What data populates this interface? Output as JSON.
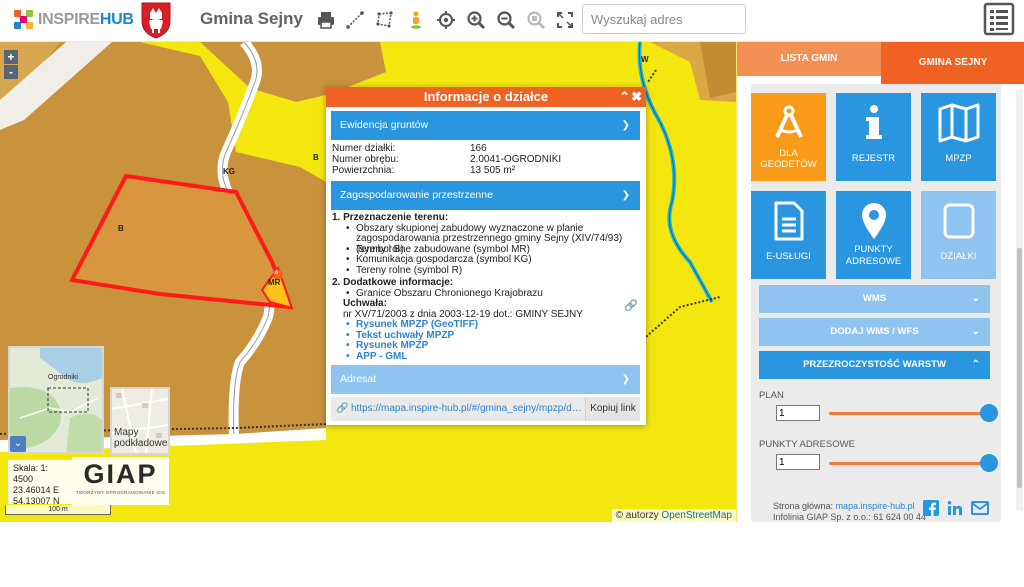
{
  "header": {
    "logo_prefix": "INSPIRE",
    "logo_suffix": "HUB",
    "title": "Gmina Sejny",
    "search_placeholder": "Wyszukaj adres",
    "tools": [
      "print-icon",
      "measure-line-icon",
      "measure-area-icon",
      "streetview-icon",
      "locate-icon",
      "zoom-in-icon",
      "zoom-out-icon",
      "zoom-box-icon",
      "fullscreen-icon"
    ]
  },
  "map": {
    "zoom_in": "+",
    "zoom_out": "-",
    "labels": {
      "w": "W",
      "kg": "KG",
      "b1": "B",
      "b2": "B",
      "mr": "MR",
      "six": "6"
    },
    "minimap_label": "Ogrodniki",
    "minimap_toggle": "⌄",
    "basemap_label": "Mapy podkładowe",
    "scale_text": "Skala: 1: 4500",
    "coord_e": "23.46014 E",
    "coord_n": "54.13007 N",
    "giap_logo": "GIAP",
    "giap_tagline": "TWORZYMY OPROGRAMOWANIE GIS",
    "scale_bar": "100 m",
    "attribution_prefix": "© autorzy",
    "attribution_link": "OpenStreetMap"
  },
  "popup": {
    "title": "Informacje o działce",
    "sections": {
      "ewidencja": "Ewidencja gruntów",
      "zagosp": "Zagospodarowanie przestrzenne",
      "adresat": "Adresat"
    },
    "fields": [
      {
        "label": "Numer działki:",
        "value": "166"
      },
      {
        "label": "Numer obrębu:",
        "value": "2.0041-OGRODNIKI"
      },
      {
        "label": "Powierzchnia:",
        "value": "13 505 m²"
      }
    ],
    "item1_title": "1.  Przeznaczenie terenu:",
    "item1_bullets": [
      "Obszary skupionej zabudowy wyznaczone w planie zagospodarowania przestrzennego gminy Sejny (XIV/74/93) (symbol B)",
      "Tereny rolne zabudowane (symbol MR)",
      "Komunikacja gospodarcza (symbol KG)",
      "Tereny rolne (symbol R)"
    ],
    "item2_title": "2.  Dodatkowe informacje:",
    "item2_bullet": "Granice Obszaru Chronionego Krajobrazu",
    "uchwala_label": "Uchwała:",
    "uchwala_text": "nr XV/71/2003 z dnia 2003-12-19 dot.: GMINY SEJNY",
    "links": [
      "Rysunek MPZP (GeoTIFF)",
      "Tekst uchwały MPZP",
      "Rysunek MPZP",
      "APP - GML"
    ],
    "share_url": "https://mapa.inspire-hub.pl/#/gmina_sejny/mpzp/dzialka/...",
    "copy_label": "Kopiuj link"
  },
  "panel": {
    "tab_lista": "LISTA GMIN",
    "tab_gmina": "GMINA SEJNY",
    "tiles": [
      {
        "label1": "DLA",
        "label2": "GEODETÓW",
        "icon": "compass-icon"
      },
      {
        "label1": "REJESTR",
        "label2": "",
        "icon": "info-icon"
      },
      {
        "label1": "MPZP",
        "label2": "",
        "icon": "map-icon"
      },
      {
        "label1": "E-USŁUGI",
        "label2": "",
        "icon": "document-icon"
      },
      {
        "label1": "PUNKTY",
        "label2": "ADRESOWE",
        "icon": "pin-icon"
      },
      {
        "label1": "DZIAŁKI",
        "label2": "",
        "icon": "parcel-icon"
      }
    ],
    "sections": [
      "WMS",
      "DODAJ WMS / WFS",
      "PRZEZROCZYSTOŚĆ WARSTW"
    ],
    "layers": [
      {
        "name": "PLAN",
        "value": "1",
        "opacity": 1
      },
      {
        "name": "PUNKTY ADRESOWE",
        "value": "1",
        "opacity": 1
      }
    ],
    "footer_label": "Strona główna:",
    "footer_link": "mapa.inspire-hub.pl",
    "footer_line2": "Infolinia GIAP Sp. z o.o.: 61 624 00 44"
  },
  "colors": {
    "accent_orange": "#f06223",
    "tile_orange": "#f99b19",
    "tile_blue": "#2b96e0",
    "tile_light": "#8fc4f1",
    "parcel_outline": "#ff1a1a",
    "map_yellow": "#f4e710",
    "map_brown": "#c9923d"
  }
}
